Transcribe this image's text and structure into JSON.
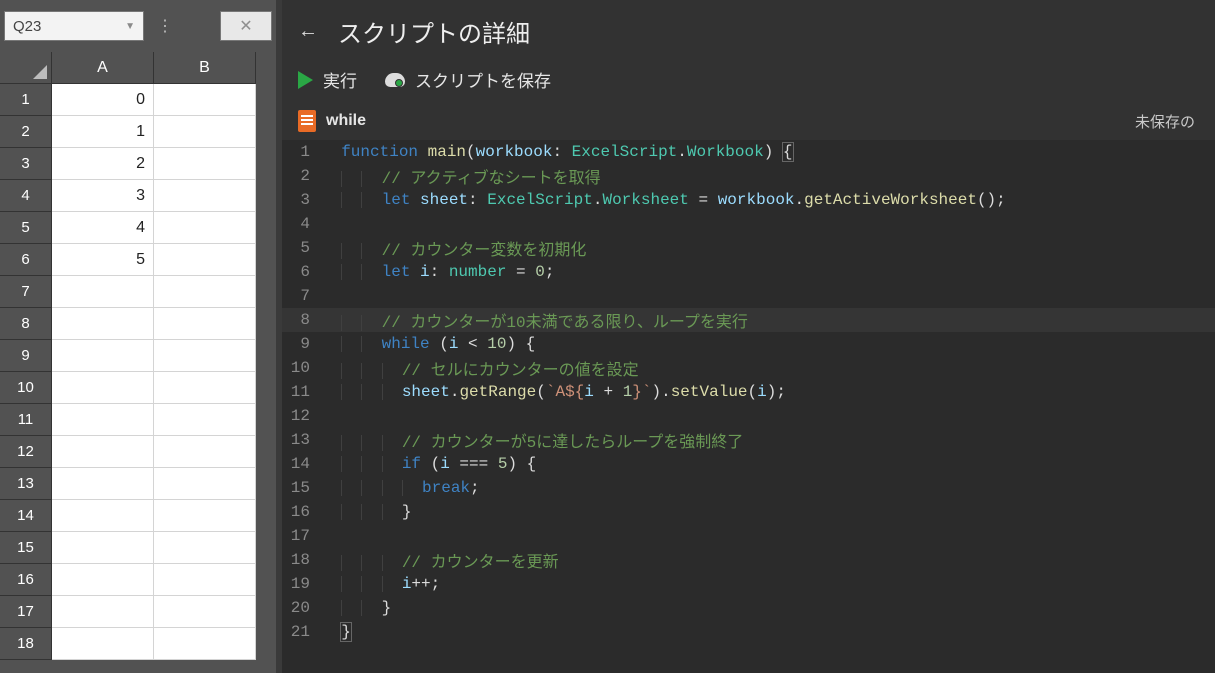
{
  "sheet": {
    "name_box": "Q23",
    "columns": [
      "A",
      "B"
    ],
    "rows": [
      1,
      2,
      3,
      4,
      5,
      6,
      7,
      8,
      9,
      10,
      11,
      12,
      13,
      14,
      15,
      16,
      17,
      18
    ],
    "data": {
      "A": [
        "0",
        "1",
        "2",
        "3",
        "4",
        "5",
        "",
        "",
        "",
        "",
        "",
        "",
        "",
        "",
        "",
        "",
        "",
        ""
      ],
      "B": [
        "",
        "",
        "",
        "",
        "",
        "",
        "",
        "",
        "",
        "",
        "",
        "",
        "",
        "",
        "",
        "",
        "",
        ""
      ]
    }
  },
  "script_panel": {
    "title": "スクリプトの詳細",
    "run_label": "実行",
    "save_label": "スクリプトを保存",
    "script_name": "while",
    "unsaved_label": "未保存の"
  },
  "code": {
    "highlight_line": 8,
    "lines": [
      {
        "n": 1,
        "indent": 0,
        "tokens": [
          [
            "kw",
            "function "
          ],
          [
            "fn",
            "main"
          ],
          [
            "punc",
            "("
          ],
          [
            "id",
            "workbook"
          ],
          [
            "punc",
            ": "
          ],
          [
            "type",
            "ExcelScript"
          ],
          [
            "punc",
            "."
          ],
          [
            "type",
            "Workbook"
          ],
          [
            "punc",
            ") "
          ],
          [
            "bhl",
            "{"
          ]
        ]
      },
      {
        "n": 2,
        "indent": 2,
        "tokens": [
          [
            "comm",
            "// アクティブなシートを取得"
          ]
        ]
      },
      {
        "n": 3,
        "indent": 2,
        "tokens": [
          [
            "kw",
            "let "
          ],
          [
            "id",
            "sheet"
          ],
          [
            "punc",
            ": "
          ],
          [
            "type",
            "ExcelScript"
          ],
          [
            "punc",
            "."
          ],
          [
            "type",
            "Worksheet"
          ],
          [
            "punc",
            " = "
          ],
          [
            "id",
            "workbook"
          ],
          [
            "punc",
            "."
          ],
          [
            "fn",
            "getActiveWorksheet"
          ],
          [
            "punc",
            "();"
          ]
        ]
      },
      {
        "n": 4,
        "indent": 0,
        "tokens": []
      },
      {
        "n": 5,
        "indent": 2,
        "tokens": [
          [
            "comm",
            "// カウンター変数を初期化"
          ]
        ]
      },
      {
        "n": 6,
        "indent": 2,
        "tokens": [
          [
            "kw",
            "let "
          ],
          [
            "id",
            "i"
          ],
          [
            "punc",
            ": "
          ],
          [
            "type",
            "number"
          ],
          [
            "punc",
            " = "
          ],
          [
            "num",
            "0"
          ],
          [
            "punc",
            ";"
          ]
        ]
      },
      {
        "n": 7,
        "indent": 0,
        "tokens": []
      },
      {
        "n": 8,
        "indent": 2,
        "tokens": [
          [
            "comm",
            "// カウンターが10未満である限り、ループを実行"
          ]
        ]
      },
      {
        "n": 9,
        "indent": 2,
        "tokens": [
          [
            "kw",
            "while"
          ],
          [
            "punc",
            " ("
          ],
          [
            "id",
            "i"
          ],
          [
            "punc",
            " < "
          ],
          [
            "num",
            "10"
          ],
          [
            "punc",
            ") {"
          ]
        ]
      },
      {
        "n": 10,
        "indent": 3,
        "tokens": [
          [
            "comm",
            "// セルにカウンターの値を設定"
          ]
        ]
      },
      {
        "n": 11,
        "indent": 3,
        "tokens": [
          [
            "id",
            "sheet"
          ],
          [
            "punc",
            "."
          ],
          [
            "fn",
            "getRange"
          ],
          [
            "punc",
            "("
          ],
          [
            "str",
            "`A${"
          ],
          [
            "id",
            "i"
          ],
          [
            "punc",
            " + "
          ],
          [
            "num",
            "1"
          ],
          [
            "str",
            "}`"
          ],
          [
            "punc",
            ")."
          ],
          [
            "fn",
            "setValue"
          ],
          [
            "punc",
            "("
          ],
          [
            "id",
            "i"
          ],
          [
            "punc",
            ");"
          ]
        ]
      },
      {
        "n": 12,
        "indent": 0,
        "tokens": []
      },
      {
        "n": 13,
        "indent": 3,
        "tokens": [
          [
            "comm",
            "// カウンターが5に達したらループを強制終了"
          ]
        ]
      },
      {
        "n": 14,
        "indent": 3,
        "tokens": [
          [
            "kw",
            "if"
          ],
          [
            "punc",
            " ("
          ],
          [
            "id",
            "i"
          ],
          [
            "punc",
            " === "
          ],
          [
            "num",
            "5"
          ],
          [
            "punc",
            ") {"
          ]
        ]
      },
      {
        "n": 15,
        "indent": 4,
        "tokens": [
          [
            "kw",
            "break"
          ],
          [
            "punc",
            ";"
          ]
        ]
      },
      {
        "n": 16,
        "indent": 3,
        "tokens": [
          [
            "punc",
            "}"
          ]
        ]
      },
      {
        "n": 17,
        "indent": 0,
        "tokens": []
      },
      {
        "n": 18,
        "indent": 3,
        "tokens": [
          [
            "comm",
            "// カウンターを更新"
          ]
        ]
      },
      {
        "n": 19,
        "indent": 3,
        "tokens": [
          [
            "id",
            "i"
          ],
          [
            "punc",
            "++;"
          ]
        ]
      },
      {
        "n": 20,
        "indent": 2,
        "tokens": [
          [
            "punc",
            "}"
          ]
        ]
      },
      {
        "n": 21,
        "indent": 0,
        "tokens": [
          [
            "bhl",
            "}"
          ]
        ]
      }
    ]
  }
}
